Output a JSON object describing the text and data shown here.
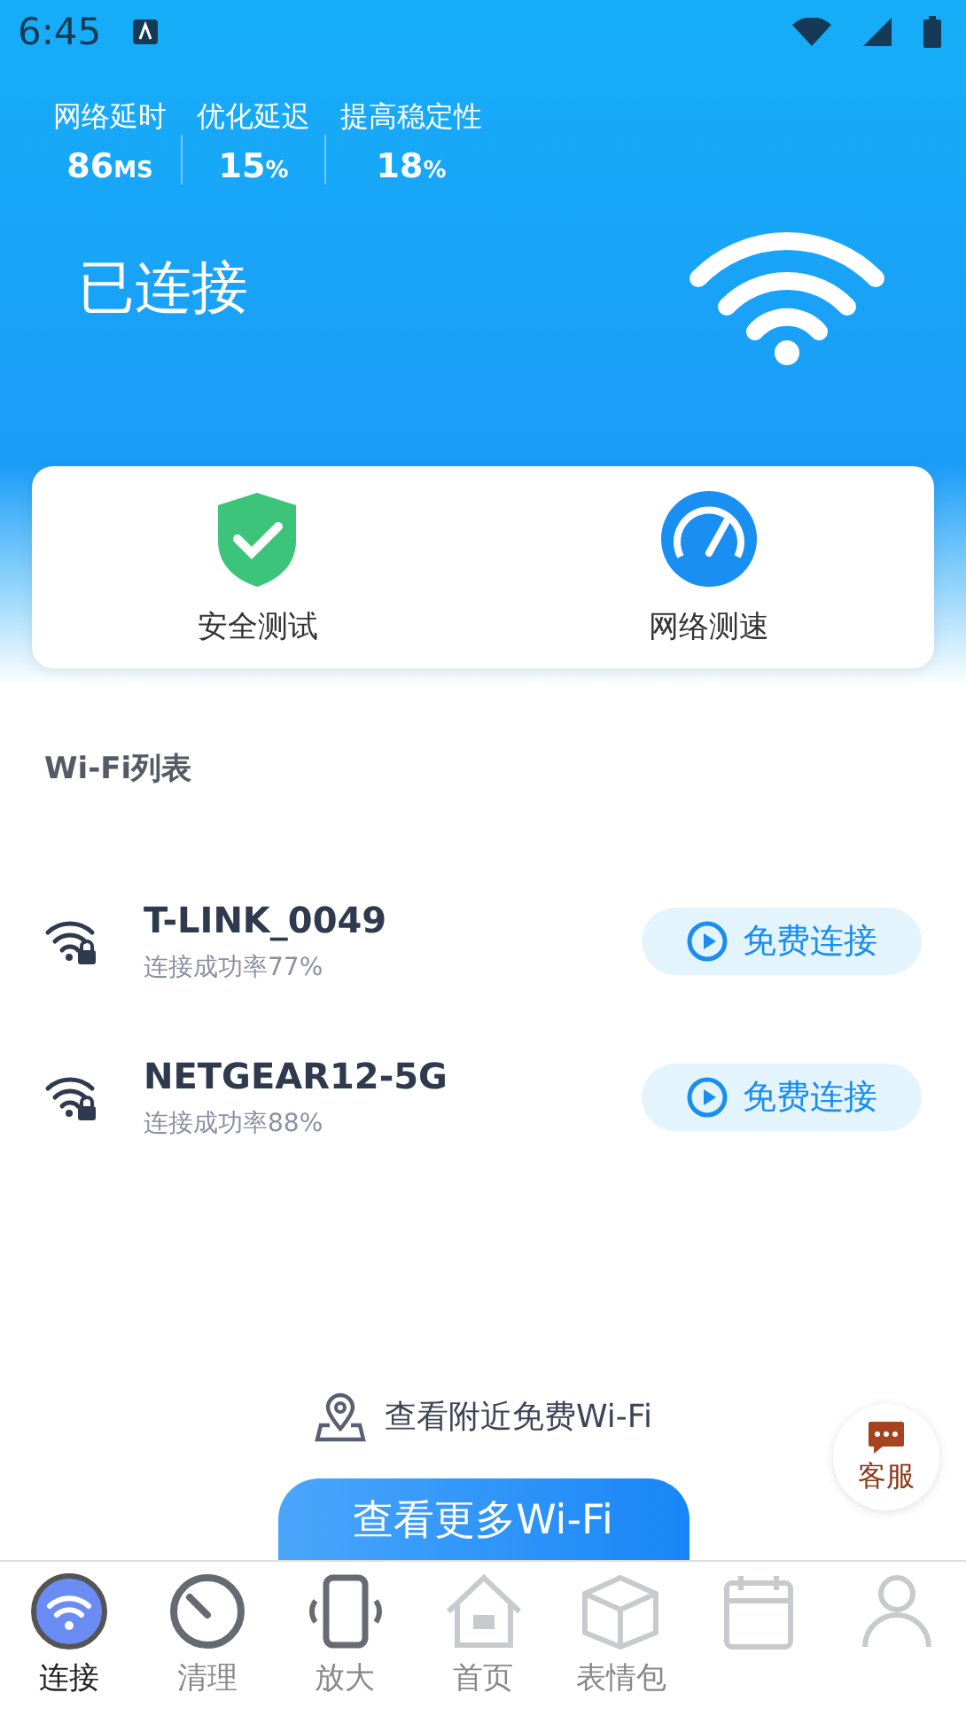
{
  "status_bar": {
    "time": "6:45"
  },
  "stats": [
    {
      "label": "网络延时",
      "value": "86",
      "unit": "MS"
    },
    {
      "label": "优化延迟",
      "value": "15",
      "unit": "%"
    },
    {
      "label": "提高稳定性",
      "value": "18",
      "unit": "%"
    }
  ],
  "connection": {
    "status": "已连接"
  },
  "tools": [
    {
      "kind": "shield",
      "label": "安全测试"
    },
    {
      "kind": "speed",
      "label": "网络测速"
    }
  ],
  "wifi_list": {
    "title": "Wi-Fi列表",
    "networks": [
      {
        "name": "T-LINK_0049",
        "rate": "连接成功率77%",
        "locked": true,
        "button": "免费连接"
      },
      {
        "name": "NETGEAR12-5G",
        "rate": "连接成功率88%",
        "locked": true,
        "button": "免费连接"
      }
    ]
  },
  "nearby_link": "查看附近免费Wi-Fi",
  "more_button": "查看更多Wi-Fi",
  "support_button": "客服",
  "bottom_nav": [
    {
      "kind": "wifi",
      "label": "连接",
      "selected": true,
      "dimmed": false
    },
    {
      "kind": "clean",
      "label": "清理",
      "selected": false,
      "dimmed": false
    },
    {
      "kind": "zoom",
      "label": "放大",
      "selected": false,
      "dimmed": false
    },
    {
      "kind": "home",
      "label": "首页",
      "selected": false,
      "dimmed": true
    },
    {
      "kind": "box",
      "label": "表情包",
      "selected": false,
      "dimmed": true
    },
    {
      "kind": "calendar",
      "selected": false,
      "dimmed": true
    },
    {
      "kind": "person",
      "selected": false,
      "dimmed": true
    }
  ]
}
